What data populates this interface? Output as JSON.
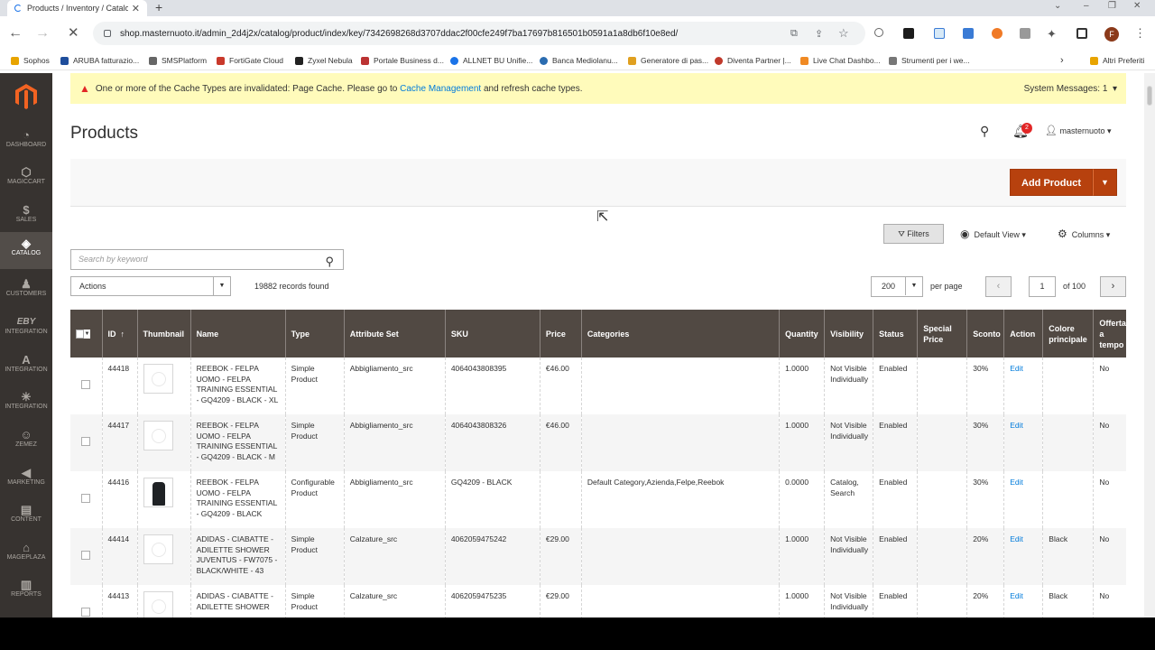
{
  "browser": {
    "tab_title": "Products / Inventory / Catalog",
    "url": "shop.masternuoto.it/admin_2d4j2x/catalog/product/index/key/7342698268d3707ddac2f00cfe249f7ba17697b816501b0591a1a8db6f10e8ed/",
    "profile_initial": "F",
    "bookmarks": [
      "Sophos",
      "ARUBA fatturazio...",
      "SMSPlatform",
      "FortiGate Cloud",
      "Zyxel Nebula",
      "Portale Business d...",
      "ALLNET BU Unifie...",
      "Banca Mediolanu...",
      "Generatore di pas...",
      "Diventa Partner |...",
      "Live Chat Dashbo...",
      "Strumenti per i we..."
    ],
    "other_bookmarks": "Altri Preferiti"
  },
  "menu": {
    "items": [
      {
        "label": "Dashboard",
        "icon": "dashboard-icon"
      },
      {
        "label": "Magiccart",
        "icon": "hexagon-icon"
      },
      {
        "label": "Sales",
        "icon": "dollar-icon"
      },
      {
        "label": "Catalog",
        "icon": "box-icon",
        "active": true
      },
      {
        "label": "Customers",
        "icon": "person-icon"
      },
      {
        "label": "Integration",
        "icon": "ebay-icon"
      },
      {
        "label": "Integration",
        "icon": "amazon-icon"
      },
      {
        "label": "Integration",
        "icon": "walmart-icon"
      },
      {
        "label": "Zemez",
        "icon": "zemez-icon"
      },
      {
        "label": "Marketing",
        "icon": "megaphone-icon"
      },
      {
        "label": "Content",
        "icon": "layout-icon"
      },
      {
        "label": "Mageplaza",
        "icon": "mageplaza-icon"
      },
      {
        "label": "Reports",
        "icon": "bar-chart-icon"
      }
    ]
  },
  "system_message": {
    "text_before": "One or more of the Cache Types are invalidated: Page Cache. Please go to ",
    "link": "Cache Management",
    "text_after": " and refresh cache types.",
    "count_label": "System Messages: 1"
  },
  "header": {
    "title": "Products",
    "notifications": "2",
    "user": "masternuoto"
  },
  "add_product_label": "Add Product",
  "grid_controls": {
    "filters": "Filters",
    "view": "Default View",
    "columns": "Columns",
    "search_placeholder": "Search by keyword",
    "actions": "Actions",
    "records": "19882 records found",
    "per_page_value": "200",
    "per_page_label": "per page",
    "page": "1",
    "page_of": "of 100"
  },
  "columns": [
    "ID",
    "Thumbnail",
    "Name",
    "Type",
    "Attribute Set",
    "SKU",
    "Price",
    "Categories",
    "Quantity",
    "Visibility",
    "Status",
    "Special Price",
    "Sconto",
    "Action",
    "Colore principale",
    "Offerta a tempo"
  ],
  "rows": [
    {
      "id": "44418",
      "thumb": "placeholder",
      "name": "REEBOK - FELPA UOMO - FELPA TRAINING ESSENTIAL - GQ4209 - BLACK - XL",
      "type": "Simple Product",
      "attr": "Abbigliamento_src",
      "sku": "4064043808395",
      "price": "€46.00",
      "cat": "",
      "qty": "1.0000",
      "vis": "Not Visible Individually",
      "status": "Enabled",
      "special": "",
      "sconto": "30%",
      "action": "Edit",
      "colore": "",
      "offerta": "No"
    },
    {
      "id": "44417",
      "thumb": "placeholder",
      "name": "REEBOK - FELPA UOMO - FELPA TRAINING ESSENTIAL - GQ4209 - BLACK - M",
      "type": "Simple Product",
      "attr": "Abbigliamento_src",
      "sku": "4064043808326",
      "price": "€46.00",
      "cat": "",
      "qty": "1.0000",
      "vis": "Not Visible Individually",
      "status": "Enabled",
      "special": "",
      "sconto": "30%",
      "action": "Edit",
      "colore": "",
      "offerta": "No"
    },
    {
      "id": "44416",
      "thumb": "photo",
      "name": "REEBOK - FELPA UOMO - FELPA TRAINING ESSENTIAL - GQ4209 - BLACK",
      "type": "Configurable Product",
      "attr": "Abbigliamento_src",
      "sku": "GQ4209 - BLACK",
      "price": "",
      "cat": "Default Category,Azienda,Felpe,Reebok",
      "qty": "0.0000",
      "vis": "Catalog, Search",
      "status": "Enabled",
      "special": "",
      "sconto": "30%",
      "action": "Edit",
      "colore": "",
      "offerta": "No"
    },
    {
      "id": "44414",
      "thumb": "placeholder",
      "name": "ADIDAS - CIABATTE - ADILETTE SHOWER JUVENTUS - FW7075 - BLACK/WHITE - 43",
      "type": "Simple Product",
      "attr": "Calzature_src",
      "sku": "4062059475242",
      "price": "€29.00",
      "cat": "",
      "qty": "1.0000",
      "vis": "Not Visible Individually",
      "status": "Enabled",
      "special": "",
      "sconto": "20%",
      "action": "Edit",
      "colore": "Black",
      "offerta": "No"
    },
    {
      "id": "44413",
      "thumb": "placeholder",
      "name": "ADIDAS - CIABATTE - ADILETTE SHOWER",
      "type": "Simple Product",
      "attr": "Calzature_src",
      "sku": "4062059475235",
      "price": "€29.00",
      "cat": "",
      "qty": "1.0000",
      "vis": "Not Visible Individually",
      "status": "Enabled",
      "special": "",
      "sconto": "20%",
      "action": "Edit",
      "colore": "Black",
      "offerta": "No"
    }
  ],
  "colors": {
    "menu_bg": "#373330",
    "header_bg": "#514943",
    "accent": "#b7410e",
    "link": "#007bdb",
    "notice_bg": "#fffbbb"
  }
}
